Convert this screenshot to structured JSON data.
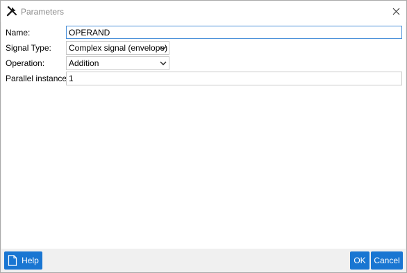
{
  "window": {
    "title": "Parameters"
  },
  "form": {
    "name": {
      "label": "Name:",
      "value": "OPERAND"
    },
    "signal_type": {
      "label": "Signal Type:",
      "value": "Complex signal (envelope)"
    },
    "operation": {
      "label": "Operation:",
      "value": "Addition"
    },
    "parallel_instance": {
      "label": "Parallel instance:",
      "value": "1"
    }
  },
  "footer": {
    "help_label": "Help",
    "ok_label": "OK",
    "cancel_label": "Cancel"
  },
  "colors": {
    "accent": "#1976d2",
    "focus_border": "#4a90d9"
  },
  "icons": {
    "title": "tools-icon",
    "close": "close-icon",
    "help": "document-icon"
  }
}
